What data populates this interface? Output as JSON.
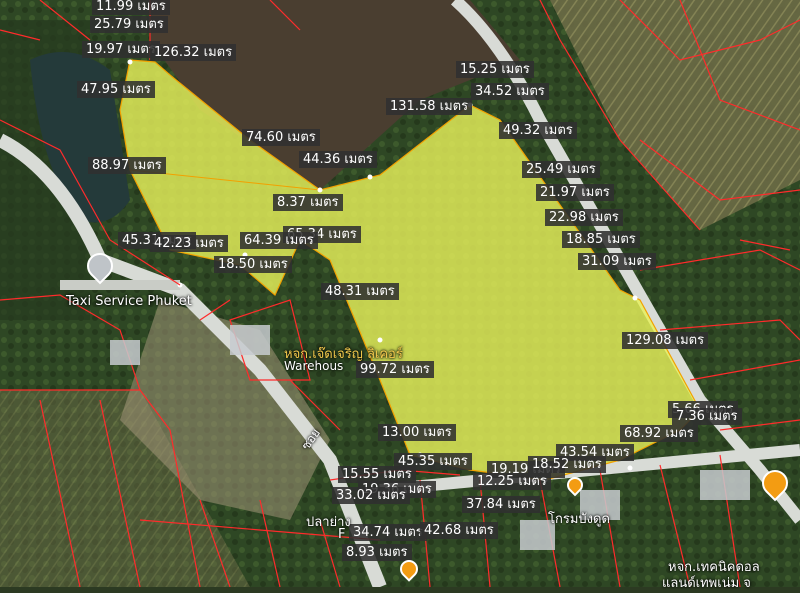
{
  "measurements": [
    "11.99 เมตร",
    "25.79 เมตร",
    "19.97 เมตร",
    "126.32 เมตร",
    "47.95 เมตร",
    "15.25 เมตร",
    "34.52 เมตร",
    "131.58 เมตร",
    "49.32 เมตร",
    "74.60 เมตร",
    "44.36 เมตร",
    "88.97 เมตร",
    "25.49 เมตร",
    "21.97 เมตร",
    "8.37 เมตร",
    "22.98 เมตร",
    "65.34 เมตร",
    "45.31 เมตร",
    "42.23 เมตร",
    "64.39 เมตร",
    "18.85 เมตร",
    "18.50 เมตร",
    "31.09 เมตร",
    "48.31 เมตร",
    "129.08 เมตร",
    "99.72 เมตร",
    "5.66 เมตร",
    "7.36 เมตร",
    "68.92 เมตร",
    "13.00 เมตร",
    "45.35 เมตร",
    "43.54 เมตร",
    "19.19 เมตร",
    "18.52 เมตร",
    "15.55 เมตร",
    "12.25 เมตร",
    "19.36 เมตร",
    "33.02 เมตร",
    "37.84 เมตร",
    "34.74 เมตร",
    "42.68 เมตร",
    "8.93 เมตร"
  ],
  "places": {
    "taxi": "Taxi Service Phuket",
    "shop_name": "หจก.เจ๊ดเจริญ ลิเคอร์",
    "warehouse": "Warehous",
    "road": "ซอย",
    "market": "ปลาย่าง",
    "plai_suffix": "F",
    "right_place": "โกรมบังดูด",
    "bottom_right_1": "หจก.เทคนิคดอล",
    "bottom_right_2": "แลนด์เทพเน่ม จ"
  },
  "pins": [
    "taxi-pin",
    "shop-pin",
    "right-pin",
    "bottom-pin"
  ],
  "colors": {
    "parcel_fill": "#e6f05a",
    "boundary": "#ff2b2b",
    "road": "#d8dbd6",
    "vegetation": "#2f4a26"
  }
}
